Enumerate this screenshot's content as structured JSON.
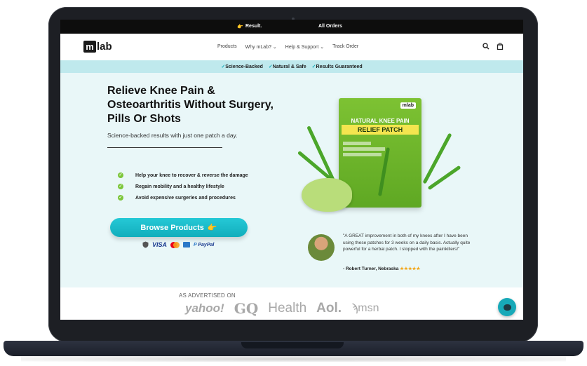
{
  "announcement": {
    "left": "Result.",
    "right": "All Orders"
  },
  "nav": {
    "logo_mark": "m",
    "logo_text": "lab",
    "links": [
      "Products",
      "Why mLab? ⌄",
      "Help & Support ⌄",
      "Track Order"
    ],
    "icons": [
      "search-icon",
      "cart-icon"
    ]
  },
  "trust_bar": [
    "Science-Backed",
    "Natural & Safe",
    "Results Guaranteed"
  ],
  "hero": {
    "headline": "Relieve Knee Pain & Osteoarthritis Without Surgery, Pills Or Shots",
    "subheadline": "Science-backed results with just one patch a day.",
    "bullets": [
      "Help your knee to recover & reverse the damage",
      "Regain mobility and a healthy lifestyle",
      "Avoid expensive surgeries and procedures"
    ],
    "cta_label": "Browse Products",
    "payments": [
      "VISA",
      "PayPal"
    ]
  },
  "product": {
    "brand": "mlab",
    "title_line1": "NATURAL KNEE PAIN",
    "title_line2": "RELIEF PATCH"
  },
  "testimonial": {
    "quote": "\"A GREAT improvement in both of my knees after I have been using these patches for 3 weeks on a daily basis. Actually quite powerful for a herbal patch. I stopped with the painkillers!\"",
    "author": "- Robert Turner, Nebraska",
    "stars": "★★★★★"
  },
  "media": {
    "label": "AS ADVERTISED ON",
    "logos": [
      "yahoo!",
      "GQ",
      "Health",
      "Aol.",
      "msn"
    ]
  },
  "colors": {
    "accent": "#17a9b8",
    "trust_bar": "#bfe9ed",
    "hero_bg": "#e9f7f8",
    "check_green": "#7cc63a"
  }
}
